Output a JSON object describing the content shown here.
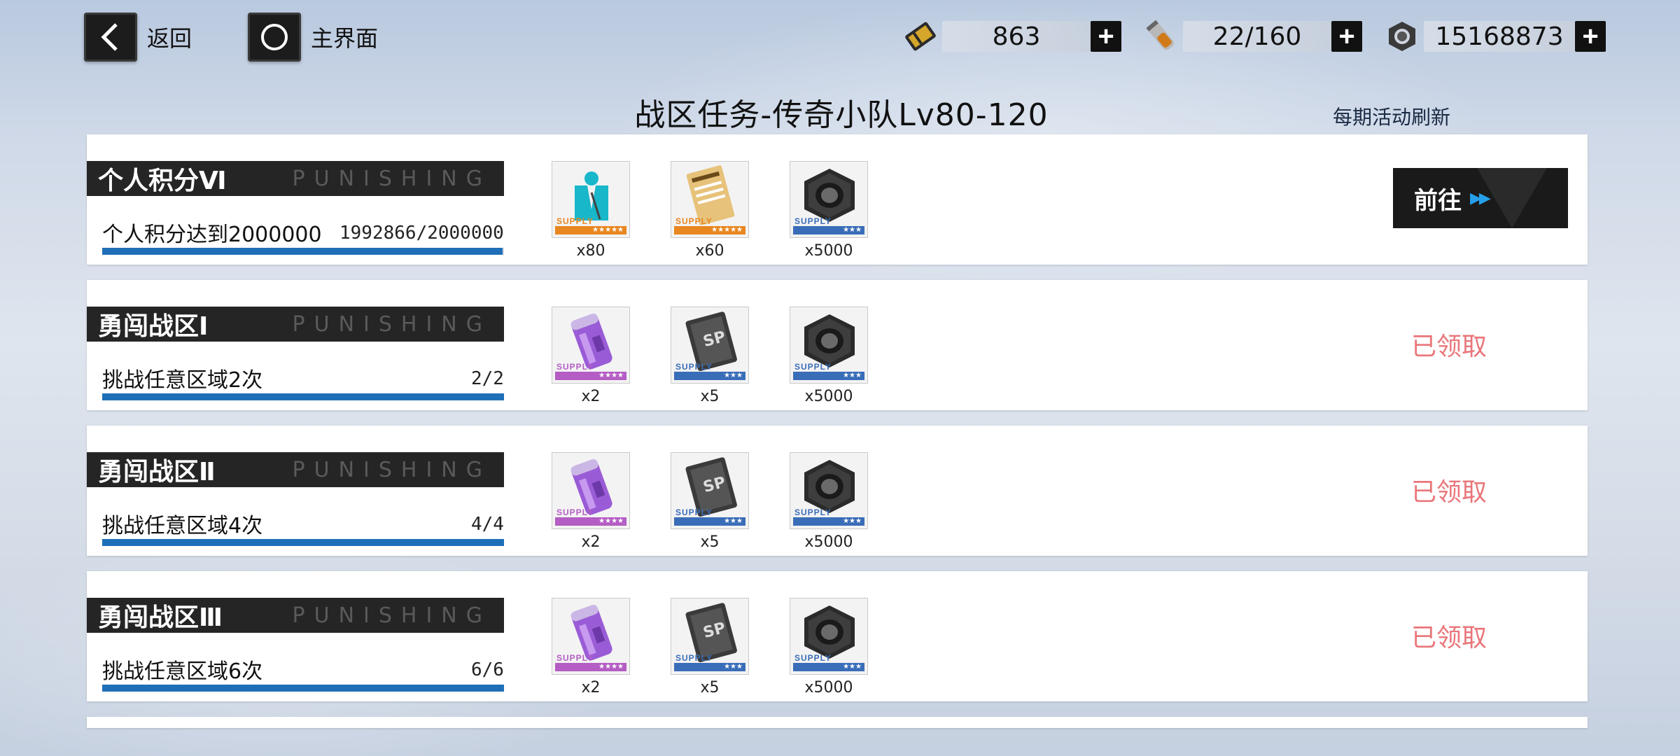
{
  "nav": {
    "back_label": "返回",
    "home_label": "主界面"
  },
  "resources": [
    {
      "icon": "ticket-icon",
      "value": "863"
    },
    {
      "icon": "energy-vial-icon",
      "value": "22/160"
    },
    {
      "icon": "cog-coin-icon",
      "value": "15168873"
    }
  ],
  "title": "战区任务-传奇小队Lv80-120",
  "refresh_note": "每期活动刷新",
  "punishing": "PUNISHING",
  "colors": {
    "progress": "#1f6fb8",
    "claimed": "#e9767a",
    "accent_arrow": "#26a0ea"
  },
  "tasks": [
    {
      "name": "个人积分Ⅵ",
      "desc": "个人积分达到2000000",
      "progress_text": "1992866/2000000",
      "progress": 0.996,
      "status": "前往",
      "rewards": [
        {
          "icon": "teal-badge-icon",
          "qty": "x80",
          "supply": "SUPPLY",
          "rarity": "★★★★★"
        },
        {
          "icon": "gold-card-icon",
          "qty": "x60",
          "supply": "SUPPLY",
          "rarity": "★★★★★"
        },
        {
          "icon": "hex-nut-icon",
          "qty": "x5000",
          "supply": "SUPPLY",
          "rarity": "★★★"
        }
      ]
    },
    {
      "name": "勇闯战区Ⅰ",
      "desc": "挑战任意区域2次",
      "progress_text": "2/2",
      "progress": 1,
      "status": "已领取",
      "rewards": [
        {
          "icon": "purple-canister-icon",
          "qty": "x2",
          "supply": "SUPPLY",
          "rarity": "★★★★"
        },
        {
          "icon": "sp-card-icon",
          "qty": "x5",
          "supply": "SUPPLY",
          "rarity": "★★★"
        },
        {
          "icon": "hex-nut-icon",
          "qty": "x5000",
          "supply": "SUPPLY",
          "rarity": "★★★"
        }
      ]
    },
    {
      "name": "勇闯战区Ⅱ",
      "desc": "挑战任意区域4次",
      "progress_text": "4/4",
      "progress": 1,
      "status": "已领取",
      "rewards": [
        {
          "icon": "purple-canister-icon",
          "qty": "x2",
          "supply": "SUPPLY",
          "rarity": "★★★★"
        },
        {
          "icon": "sp-card-icon",
          "qty": "x5",
          "supply": "SUPPLY",
          "rarity": "★★★"
        },
        {
          "icon": "hex-nut-icon",
          "qty": "x5000",
          "supply": "SUPPLY",
          "rarity": "★★★"
        }
      ]
    },
    {
      "name": "勇闯战区Ⅲ",
      "desc": "挑战任意区域6次",
      "progress_text": "6/6",
      "progress": 1,
      "status": "已领取",
      "rewards": [
        {
          "icon": "purple-canister-icon",
          "qty": "x2",
          "supply": "SUPPLY",
          "rarity": "★★★★"
        },
        {
          "icon": "sp-card-icon",
          "qty": "x5",
          "supply": "SUPPLY",
          "rarity": "★★★"
        },
        {
          "icon": "hex-nut-icon",
          "qty": "x5000",
          "supply": "SUPPLY",
          "rarity": "★★★"
        }
      ]
    }
  ]
}
